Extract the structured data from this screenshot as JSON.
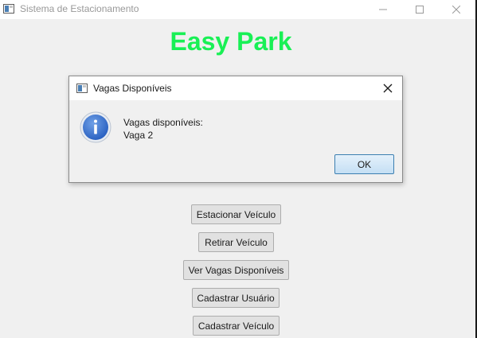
{
  "window": {
    "title": "Sistema de Estacionamento",
    "controls": {
      "minimize": "minimize-icon",
      "maximize": "maximize-icon",
      "close": "close-icon"
    }
  },
  "main": {
    "brand_title": "Easy Park",
    "brand_color": "#19f055",
    "buttons": [
      "Estacionar Veículo",
      "Retirar Veículo",
      "Ver Vagas Disponíveis",
      "Cadastrar Usuário",
      "Cadastrar Veículo"
    ]
  },
  "dialog": {
    "title": "Vagas Disponíveis",
    "icon": "info-icon",
    "message_line1": "Vagas disponíveis:",
    "message_line2": "Vaga 2",
    "ok_label": "OK"
  }
}
